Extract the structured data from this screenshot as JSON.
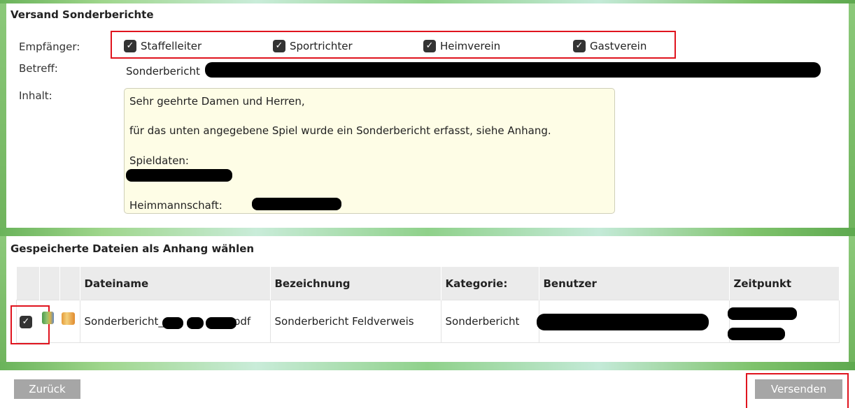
{
  "send_section": {
    "title": "Versand Sonderberichte",
    "recipients_label": "Empfänger:",
    "recipients": [
      {
        "label": "Staffelleiter",
        "checked": true
      },
      {
        "label": "Sportrichter",
        "checked": true
      },
      {
        "label": "Heimverein",
        "checked": true
      },
      {
        "label": "Gastverein",
        "checked": true
      }
    ],
    "subject_label": "Betreff:",
    "subject_value": "Sonderbericht",
    "content_label": "Inhalt:",
    "content_lines": {
      "greeting": "Sehr geehrte Damen und Herren,",
      "body": "für das unten angegebene Spiel wurde ein Sonderbericht erfasst, siehe Anhang.",
      "match_data": "Spieldaten:",
      "home_team": "Heimmannschaft:"
    }
  },
  "files_section": {
    "title": "Gespeicherte Dateien als Anhang wählen",
    "columns": [
      "",
      "",
      "",
      "Dateiname",
      "Bezeichnung",
      "Kategorie:",
      "Benutzer",
      "Zeitpunkt"
    ],
    "rows": [
      {
        "checked": true,
        "filename_prefix": "Sonderbericht_",
        "filename_suffix": "pdf",
        "description": "Sonderbericht Feldverweis",
        "category": "Sonderbericht"
      }
    ]
  },
  "actions": {
    "back_label": "Zurück",
    "send_label": "Versenden"
  },
  "colors": {
    "accent_red": "#e0141e",
    "content_bg": "#fefde6",
    "button_gray": "#a6a6a6"
  },
  "icons": [
    "checkbox-checked-icon",
    "document-icon",
    "trash-icon"
  ]
}
